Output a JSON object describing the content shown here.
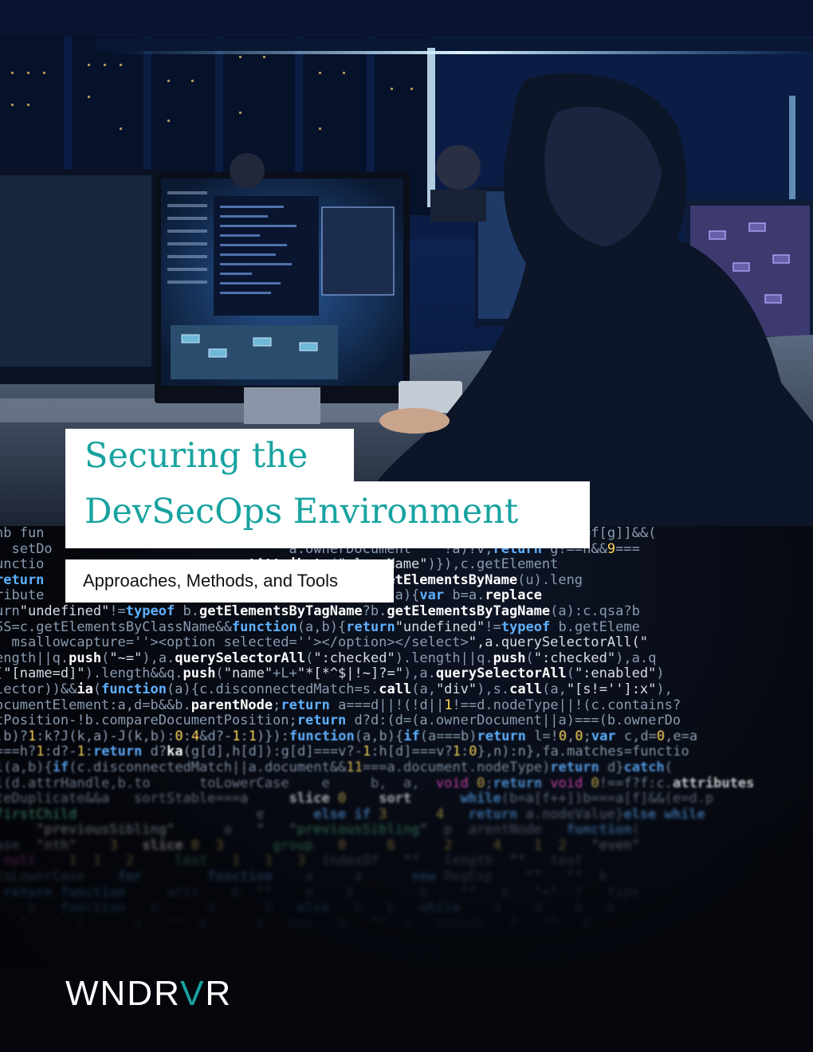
{
  "cover": {
    "title_line1": "Securing the",
    "title_line2": "DevSecOps Environment",
    "subtitle": "Approaches, Methods, and Tools",
    "logo": {
      "pre": "WNDR",
      "accent": "V",
      "post": "R"
    },
    "accent_color": "#17a3a0"
  },
  "code": [
    "nb fun         (q-0){                                      while(g--)c[e=f[g]]&&(",
    "  setDo                             a.ownerDocument    !a)?v;return g!==n&&9===",
    "unctio                       getAttribute(\"className\")}),c.getElement",
    "return                          entsByName||!n.getElementsByName(u).leng",
    "ribute                      d.filter.ID=function(a){var b=a.replace",
    "urn\"undefined\"!=typeof b.getElementsByTagName?b.getElementsByTagName(a):c.qsa?b",
    "SS=c.getElementsByClassName&&function(a,b){return\"undefined\"!=typeof b.getEleme",
    "  msallowcapture=''><option selected=''></option></select>\",a.querySelectorAll(\"",
    "ength||q.push(\"~=\"),a.querySelectorAll(\":checked\").length||q.push(\":checked\"),a.q",
    "(\"[name=d]\").length&&q.push(\"name\"+L+\"*[*^$|!~]?=\"),a.querySelectorAll(\":enabled\")",
    "lector))&&ia(function(a){c.disconnectedMatch=s.call(a,\"div\"),s.call(a,\"[s!='']:x\"),",
    "ocumentElement:a,d=b&&b.parentNode;return a===d||!(!d||1!==d.nodeType||!(c.contains?",
    "tPosition-!b.compareDocumentPosition;return d?d:(d=(a.ownerDocument||a)===(b.ownerDo",
    ",b)?1:k?J(k,a)-J(k,b):0:4&d?-1:1)}):function(a,b){if(a===b)return l=!0,0;var c,d=0,e=a",
    "===h?1:d?-1:return d?ka(g[d],h[d]):g[d]===v?-1:h[d]===v?1:0},n):n},fa.matches=functio",
    "l(a,b){if(c.disconnectedMatch||a.document&&11===a.document.nodeType)return d}catch(",
    "l(d.attrHandle,b.to      toLowerCase    e     b,  a,  void 0;return void 0!==f?f:c.attributes",
    "teDuplicate&&a   sortStable===a     slice 0    sort      while(b=a[f++])b===a[f]&&(e=d.p",
    "firstChild                      e      else if 3      4   return a.nodeValue}else while",
    "     \"previousSibling\"      a   \"   \"previousSibling\"  p  arentNode   function(",
    "ase  \"nth\"    3   slice 0  3      group   0     6      2     4    1  2   \"even\"",
    " null    1  1   2     lost   1   1   3  indexOf   \"\"   length  \"\"   test",
    "toLowerCase    for        function    a     a      new RegExp    \"\"   \"\"  b",
    " return function     attr    b  \"\"    e    b        b    \"\"   b   \"=\"  f   type",
    "    b   function   b      d      b   else   b   b   while    d    d    b   b",
    "   \"   \"  f      a   \"\"  b      b   has   b   \"\"  e   pseudo   f   \"\"   b"
  ]
}
